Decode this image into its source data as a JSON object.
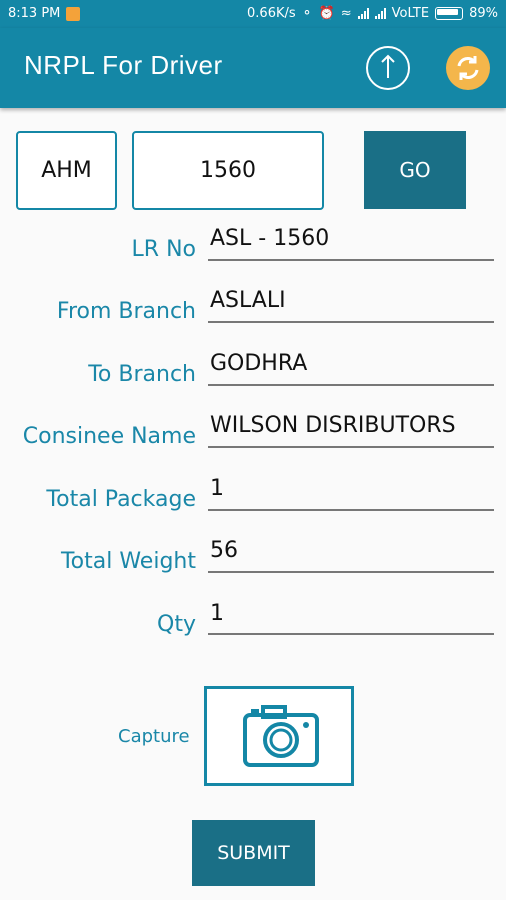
{
  "status_bar": {
    "time": "8:13 PM",
    "network_speed": "0.66K/s",
    "carrier": "VoLTE",
    "battery": "89%"
  },
  "toolbar": {
    "title": "NRPL For Driver"
  },
  "search": {
    "prefix_value": "AHM",
    "number_value": "1560",
    "go_label": "GO"
  },
  "form": {
    "lr_no": {
      "label": "LR No",
      "value": "ASL - 1560"
    },
    "from_branch": {
      "label": "From Branch",
      "value": "ASLALI"
    },
    "to_branch": {
      "label": "To Branch",
      "value": "GODHRA"
    },
    "consignee_name": {
      "label": "Consinee Name",
      "value": "WILSON DISRIBUTORS"
    },
    "total_package": {
      "label": "Total Package",
      "value": "1"
    },
    "total_weight": {
      "label": "Total Weight",
      "value": "56"
    },
    "qty": {
      "label": "Qty",
      "value": "1"
    }
  },
  "capture": {
    "label": "Capture"
  },
  "submit": {
    "label": "SUBMIT"
  },
  "colors": {
    "primary": "#1487a6",
    "button": "#1a6f86",
    "label": "#1a87a8",
    "sync": "#f4b64b"
  }
}
